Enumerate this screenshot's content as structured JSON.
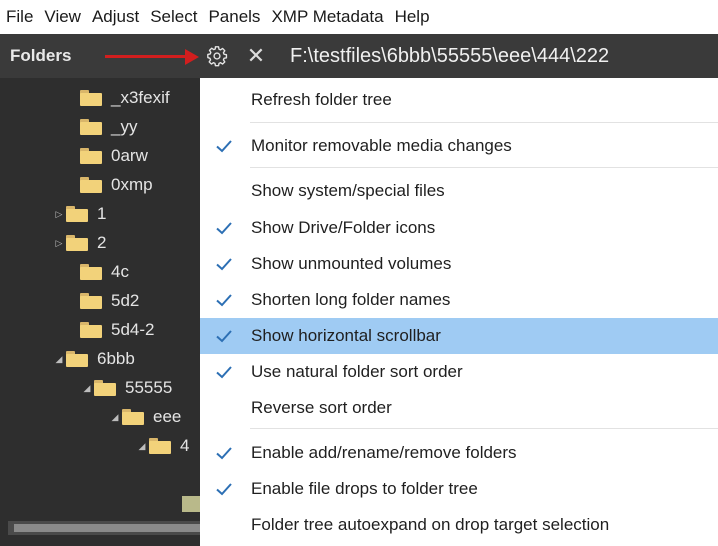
{
  "menubar": [
    "File",
    "View",
    "Adjust",
    "Select",
    "Panels",
    "XMP Metadata",
    "Help"
  ],
  "panel": {
    "folders_tab": "Folders",
    "path": "F:\\testfiles\\6bbb\\55555\\eee\\444\\222"
  },
  "tree": [
    {
      "label": "_x3fexif",
      "expander": ""
    },
    {
      "label": "_yy",
      "expander": ""
    },
    {
      "label": "0arw",
      "expander": ""
    },
    {
      "label": "0xmp",
      "expander": ""
    },
    {
      "label": "1",
      "expander": "▷"
    },
    {
      "label": "2",
      "expander": "▷"
    },
    {
      "label": "4c",
      "expander": ""
    },
    {
      "label": "5d2",
      "expander": ""
    },
    {
      "label": "5d4-2",
      "expander": ""
    },
    {
      "label": "6bbb",
      "expander": "◢"
    },
    {
      "label": "55555",
      "expander": "◢"
    },
    {
      "label": "eee",
      "expander": "◢"
    },
    {
      "label": "4",
      "expander": "◢"
    }
  ],
  "menu": [
    {
      "label": "Refresh folder tree",
      "checked": false
    },
    {
      "label": "Monitor removable media changes",
      "checked": true
    },
    {
      "label": "Show system/special files",
      "checked": false
    },
    {
      "label": "Show Drive/Folder icons",
      "checked": true
    },
    {
      "label": "Show unmounted volumes",
      "checked": true
    },
    {
      "label": "Shorten long folder names",
      "checked": true
    },
    {
      "label": "Show horizontal scrollbar",
      "checked": true,
      "highlighted": true
    },
    {
      "label": "Use natural folder sort order",
      "checked": true
    },
    {
      "label": "Reverse sort order",
      "checked": false
    },
    {
      "label": "Enable add/rename/remove folders",
      "checked": true
    },
    {
      "label": "Enable file drops to folder tree",
      "checked": true
    },
    {
      "label": "Folder tree autoexpand on drop target selection",
      "checked": false
    }
  ],
  "colors": {
    "highlight": "#9fcbf3",
    "check": "#2c6fb4",
    "arrow": "#d21e1e"
  },
  "icons": {
    "settings": "gear-icon",
    "close": "close-icon",
    "folder": "folder-icon",
    "check": "checkmark-icon"
  }
}
